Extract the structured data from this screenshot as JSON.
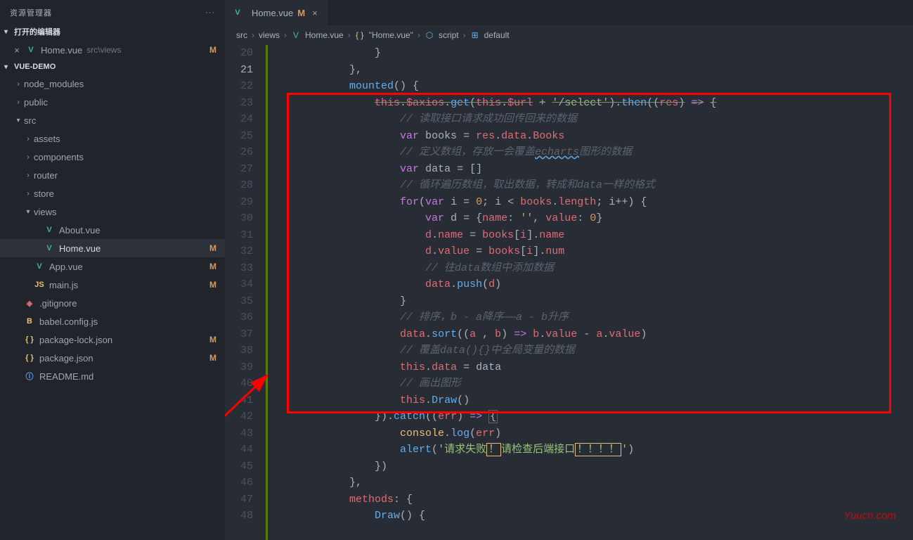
{
  "explorer": {
    "title": "资源管理器",
    "openEditors": {
      "header": "打开的编辑器",
      "item": {
        "name": "Home.vue",
        "path": "src\\views",
        "status": "M"
      }
    },
    "project": "VUE-DEMO",
    "tree": [
      {
        "label": "node_modules",
        "type": "folder",
        "open": false,
        "indent": 1
      },
      {
        "label": "public",
        "type": "folder",
        "open": false,
        "indent": 1
      },
      {
        "label": "src",
        "type": "folder",
        "open": true,
        "indent": 1
      },
      {
        "label": "assets",
        "type": "folder",
        "open": false,
        "indent": 2
      },
      {
        "label": "components",
        "type": "folder",
        "open": false,
        "indent": 2
      },
      {
        "label": "router",
        "type": "folder",
        "open": false,
        "indent": 2
      },
      {
        "label": "store",
        "type": "folder",
        "open": false,
        "indent": 2
      },
      {
        "label": "views",
        "type": "folder",
        "open": true,
        "indent": 2
      },
      {
        "label": "About.vue",
        "type": "vue",
        "indent": 3
      },
      {
        "label": "Home.vue",
        "type": "vue",
        "indent": 3,
        "status": "M",
        "selected": true
      },
      {
        "label": "App.vue",
        "type": "vue",
        "indent": 2,
        "status": "M"
      },
      {
        "label": "main.js",
        "type": "js",
        "indent": 2,
        "status": "M"
      },
      {
        "label": ".gitignore",
        "type": "git",
        "indent": 1
      },
      {
        "label": "babel.config.js",
        "type": "babel",
        "indent": 1
      },
      {
        "label": "package-lock.json",
        "type": "json",
        "indent": 1,
        "status": "M"
      },
      {
        "label": "package.json",
        "type": "json",
        "indent": 1,
        "status": "M"
      },
      {
        "label": "README.md",
        "type": "md",
        "indent": 1
      }
    ]
  },
  "tab": {
    "name": "Home.vue",
    "status": "M"
  },
  "breadcrumb": [
    "src",
    "views",
    "Home.vue",
    "\"Home.vue\"",
    "script",
    "default"
  ],
  "code": {
    "start": 20,
    "lines": [
      {
        "n": 20,
        "html": "                <span class='p'>}</span>"
      },
      {
        "n": 21,
        "html": "            <span class='p'>},</span>",
        "current": true
      },
      {
        "n": 22,
        "html": "            <span class='fn'>mounted</span><span class='p'>() {</span>"
      },
      {
        "n": 23,
        "html": "                <span class='v strike'>this</span><span class='p strike'>.</span><span class='prop strike'>$axios</span><span class='p strike'>.</span><span class='fn strike'>get</span><span class='p strike'>(</span><span class='v strike'>this</span><span class='p strike'>.</span><span class='prop strike'>$url</span> <span class='p strike'>+</span> <span class='s strike'>'/select'</span><span class='p strike'>).</span><span class='fn strike'>then</span><span class='p strike'>((</span><span class='v strike'>res</span><span class='p strike'>)</span> <span class='k strike'>=></span> <span class='p strike'>{</span>"
      },
      {
        "n": 24,
        "html": "                    <span class='c'>// 读取接口请求成功回传回来的数据</span>"
      },
      {
        "n": 25,
        "html": "                    <span class='k'>var</span> <span class='p'>books</span> <span class='p'>=</span> <span class='v'>res</span><span class='p'>.</span><span class='prop'>data</span><span class='p'>.</span><span class='prop'>Books</span>"
      },
      {
        "n": 26,
        "html": "                    <span class='c'>// 定义数组，存放一会覆盖<span class='wavy'>echarts</span>图形的数据</span>"
      },
      {
        "n": 27,
        "html": "                    <span class='k'>var</span> <span class='p'>data</span> <span class='p'>=</span> <span class='p'>[]</span>"
      },
      {
        "n": 28,
        "html": "                    <span class='c'>// 循环遍历数组，取出数据，转成和data一样的格式</span>"
      },
      {
        "n": 29,
        "html": "                    <span class='k'>for</span><span class='p'>(</span><span class='k'>var</span> <span class='p'>i</span> <span class='p'>=</span> <span class='n'>0</span><span class='p'>;</span> <span class='p'>i</span> <span class='p'>&lt;</span> <span class='v'>books</span><span class='p'>.</span><span class='prop'>length</span><span class='p'>;</span> <span class='p'>i++) {</span>"
      },
      {
        "n": 30,
        "html": "                        <span class='k'>var</span> <span class='p'>d</span> <span class='p'>=</span> <span class='p'>{</span><span class='prop'>name</span><span class='p'>:</span> <span class='s'>''</span><span class='p'>,</span> <span class='prop'>value</span><span class='p'>:</span> <span class='n'>0</span><span class='p'>}</span>"
      },
      {
        "n": 31,
        "html": "                        <span class='v'>d</span><span class='p'>.</span><span class='prop'>name</span> <span class='p'>=</span> <span class='v'>books</span><span class='p'>[</span><span class='v'>i</span><span class='p'>].</span><span class='prop'>name</span>"
      },
      {
        "n": 32,
        "html": "                        <span class='v'>d</span><span class='p'>.</span><span class='prop'>value</span> <span class='p'>=</span> <span class='v'>books</span><span class='p'>[</span><span class='v'>i</span><span class='p'>].</span><span class='prop'>num</span>"
      },
      {
        "n": 33,
        "html": "                        <span class='c'>// 往data数组中添加数据</span>"
      },
      {
        "n": 34,
        "html": "                        <span class='v'>data</span><span class='p'>.</span><span class='fn'>push</span><span class='p'>(</span><span class='v'>d</span><span class='p'>)</span>"
      },
      {
        "n": 35,
        "html": "                    <span class='p'>}</span>"
      },
      {
        "n": 36,
        "html": "                    <span class='c'>// 排序，b - a降序——a - b升序</span>"
      },
      {
        "n": 37,
        "html": "                    <span class='v'>data</span><span class='p'>.</span><span class='fn'>sort</span><span class='p'>((</span><span class='v'>a</span> <span class='p'>,</span> <span class='v'>b</span><span class='p'>)</span> <span class='k'>=></span> <span class='v'>b</span><span class='p'>.</span><span class='prop'>value</span> <span class='p'>-</span> <span class='v'>a</span><span class='p'>.</span><span class='prop'>value</span><span class='p'>)</span>"
      },
      {
        "n": 38,
        "html": "                    <span class='c'>// 覆盖data(){}中全局变量的数据</span>"
      },
      {
        "n": 39,
        "html": "                    <span class='v'>this</span><span class='p'>.</span><span class='prop'>data</span> <span class='p'>=</span> <span class='p'>data</span>"
      },
      {
        "n": 40,
        "html": "                    <span class='c'>// 画出图形</span>"
      },
      {
        "n": 41,
        "html": "                    <span class='v'>this</span><span class='p'>.</span><span class='fn'>Draw</span><span class='p'>()</span>"
      },
      {
        "n": 42,
        "html": "                <span class='p'>}).</span><span class='fn'>catch</span><span class='p'>((</span><span class='v'>err</span><span class='p'>)</span> <span class='k'>=></span> <span class='p brace-hl'>{</span>"
      },
      {
        "n": 43,
        "html": "                    <span class='this'>console</span><span class='p'>.</span><span class='fn'>log</span><span class='p'>(</span><span class='v'>err</span><span class='p'>)</span>"
      },
      {
        "n": 44,
        "html": "                    <span class='fn'>alert</span><span class='p'>(</span><span class='s'>'请求失败<span class='box-warn'>！</span>请检查后端接口<span class='box-warn'>！！！！</span>'</span><span class='p'>)</span>"
      },
      {
        "n": 45,
        "html": "                <span class='p'>})</span>"
      },
      {
        "n": 46,
        "html": "            <span class='p'>},</span>"
      },
      {
        "n": 47,
        "html": "            <span class='prop'>methods</span><span class='p'>: {</span>"
      },
      {
        "n": 48,
        "html": "                <span class='fn'>Draw</span><span class='p'>() {</span>"
      }
    ]
  },
  "watermark": "Yuucn.com"
}
